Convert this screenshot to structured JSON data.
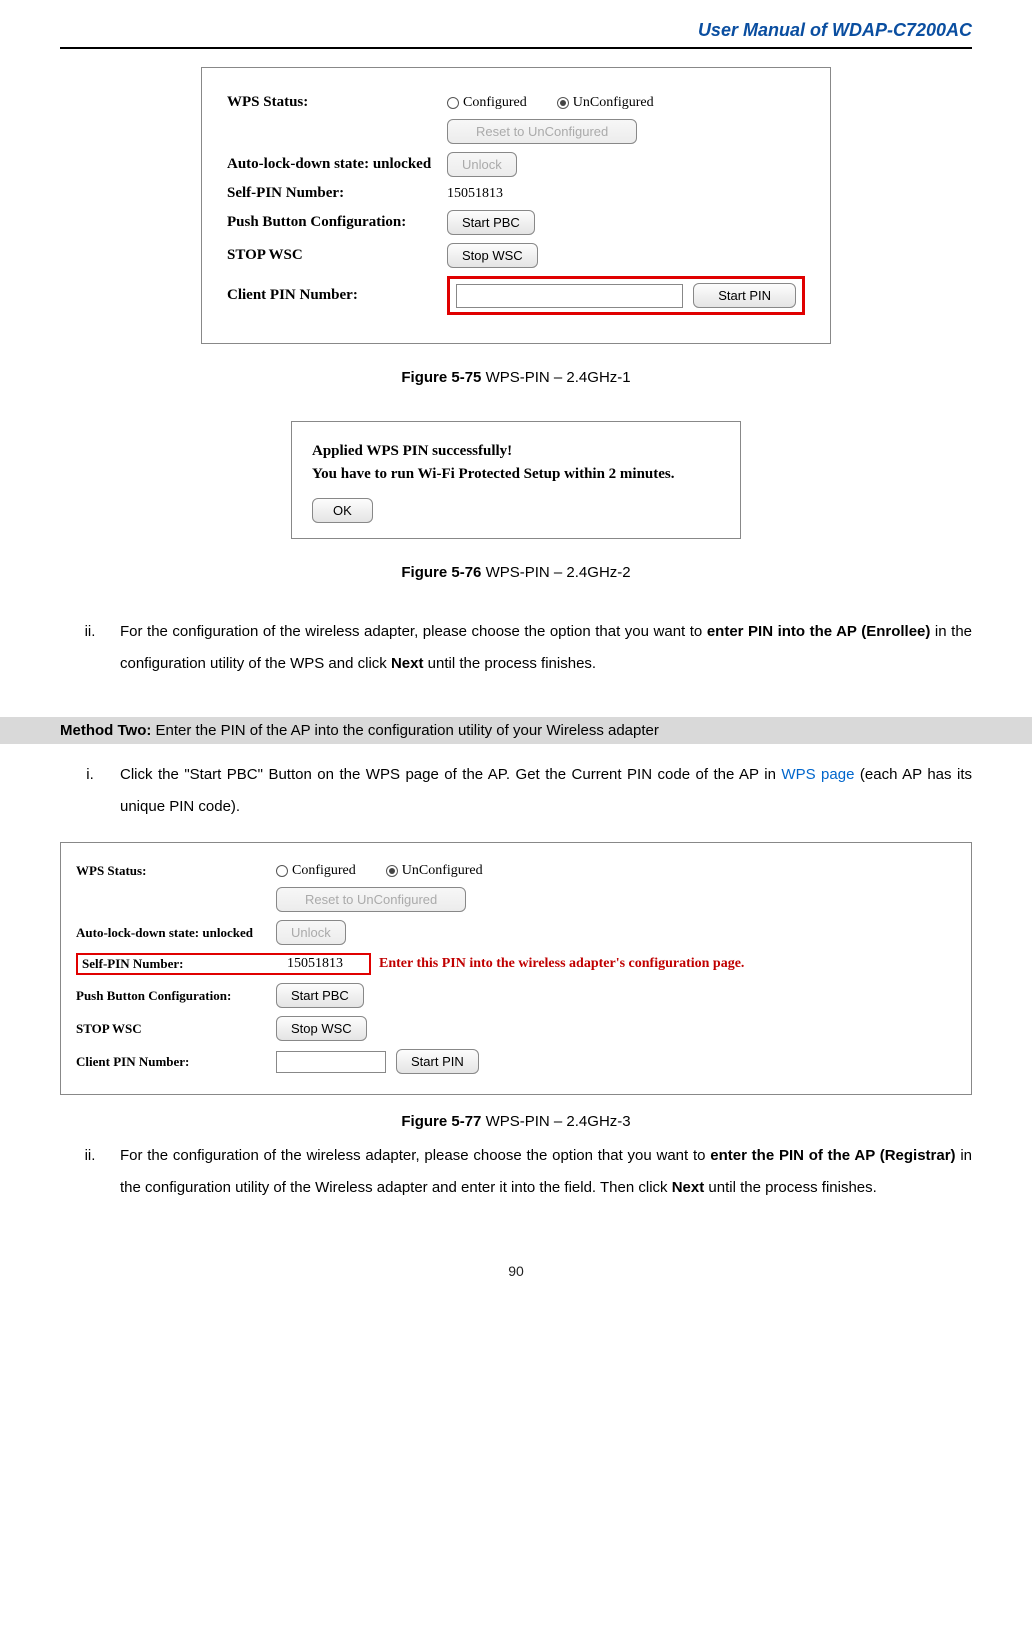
{
  "header": {
    "title": "User Manual of WDAP-C7200AC"
  },
  "panel1": {
    "wps_status_label": "WPS Status:",
    "configured_label": "Configured",
    "unconfigured_label": "UnConfigured",
    "reset_btn": "Reset to UnConfigured",
    "autolock_label": "Auto-lock-down state: unlocked",
    "unlock_btn": "Unlock",
    "selfpin_label": "Self-PIN Number:",
    "selfpin_value": "15051813",
    "pbc_label": "Push Button Configuration:",
    "start_pbc_btn": "Start PBC",
    "stopwsc_label": "STOP WSC",
    "stop_wsc_btn": "Stop WSC",
    "clientpin_label": "Client PIN Number:",
    "start_pin_btn": "Start PIN"
  },
  "fig75": {
    "bold": "Figure 5-75",
    "text": " WPS-PIN – 2.4GHz-1"
  },
  "panel2": {
    "line1": "Applied WPS PIN successfully!",
    "line2": "You have to run Wi-Fi Protected Setup within 2 minutes.",
    "ok_btn": "OK"
  },
  "fig76": {
    "bold": "Figure 5-76",
    "text": " WPS-PIN – 2.4GHz-2"
  },
  "para_ii_1": {
    "num": "ii.",
    "pre": "For the configuration of the wireless adapter, please choose the option that you want to ",
    "bold1": "enter PIN into the AP (Enrollee)",
    "mid": " in the configuration utility of the WPS and click ",
    "bold2": "Next",
    "post": " until the process finishes."
  },
  "method_two": {
    "bold": "Method Two:",
    "text": " Enter the PIN of the AP into the configuration utility of your Wireless adapter"
  },
  "para_i": {
    "num": "i.",
    "pre": "Click the \"Start PBC\" Button on the WPS page of the AP. Get the Current PIN code of the AP in ",
    "link": "WPS page",
    "post": " (each AP has its unique PIN code)."
  },
  "panel3": {
    "wps_status_label": "WPS Status:",
    "configured_label": "Configured",
    "unconfigured_label": "UnConfigured",
    "reset_btn": "Reset to UnConfigured",
    "autolock_label": "Auto-lock-down state: unlocked",
    "unlock_btn": "Unlock",
    "selfpin_label": "Self-PIN Number:",
    "selfpin_value": "15051813",
    "red_note": "Enter this PIN into the wireless adapter's configuration page.",
    "pbc_label": "Push Button Configuration:",
    "start_pbc_btn": "Start PBC",
    "stopwsc_label": "STOP WSC",
    "stop_wsc_btn": "Stop WSC",
    "clientpin_label": "Client PIN Number:",
    "start_pin_btn": "Start PIN"
  },
  "fig77": {
    "bold": "Figure 5-77",
    "text": " WPS-PIN – 2.4GHz-3"
  },
  "para_ii_2": {
    "num": "ii.",
    "pre": "For the configuration of the wireless adapter, please choose the option that you want to ",
    "bold1": "enter the PIN of the AP (Registrar)",
    "mid": " in the configuration utility of the Wireless adapter and enter it into the field. Then click ",
    "bold2": "Next",
    "post": " until the process finishes."
  },
  "page_number": "90"
}
